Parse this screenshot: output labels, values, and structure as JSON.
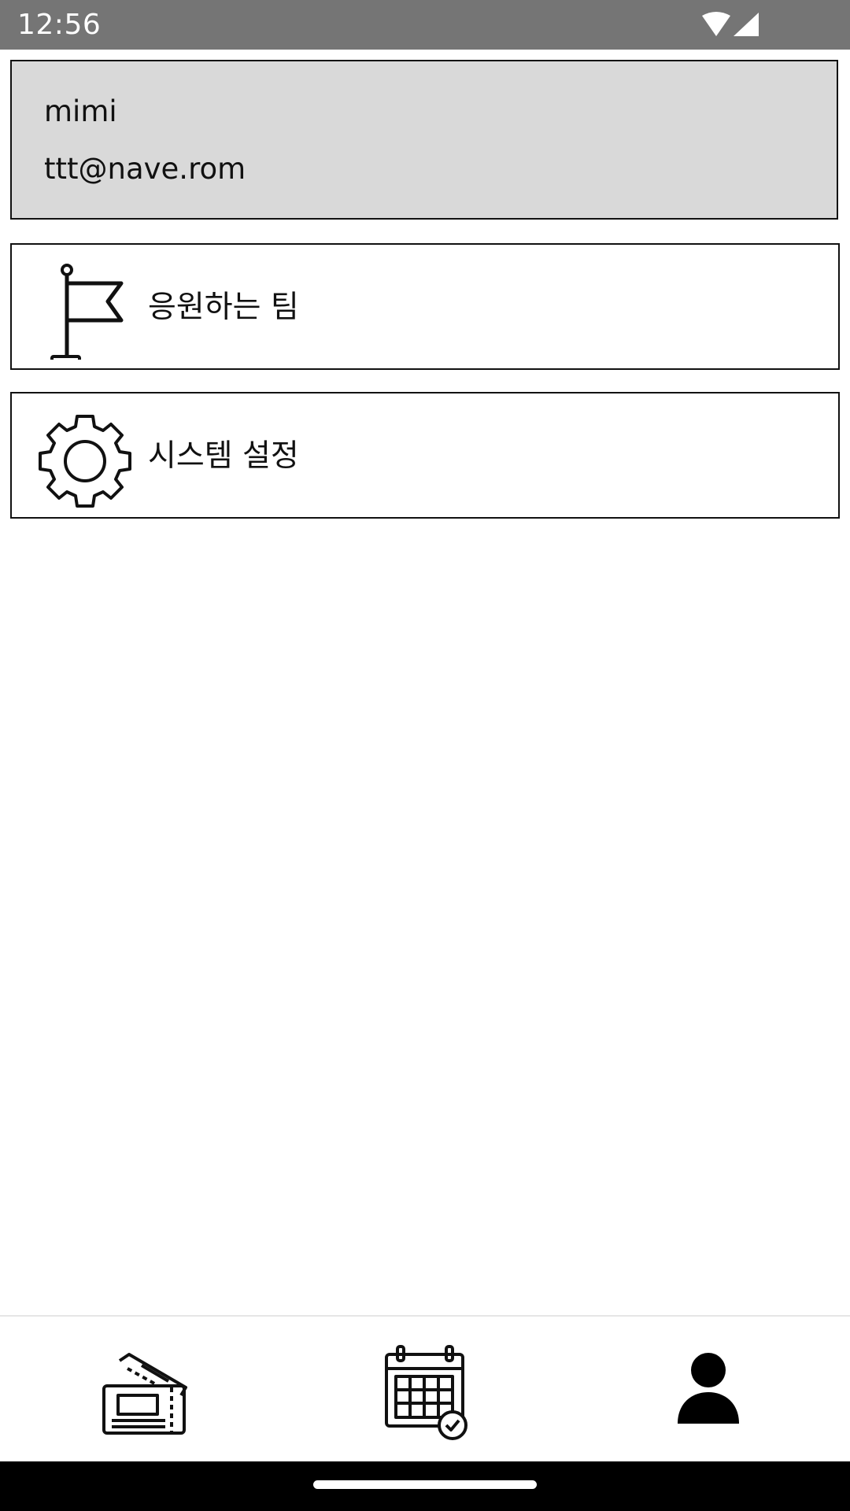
{
  "status_bar": {
    "time": "12:56",
    "icons": [
      "wifi-icon",
      "cellular-signal-icon"
    ]
  },
  "profile": {
    "name": "mimi",
    "email": "ttt@nave.rom"
  },
  "menu": {
    "items": [
      {
        "label": "응원하는 팀",
        "icon": "flag-icon"
      },
      {
        "label": "시스템 설정",
        "icon": "gear-icon"
      }
    ]
  },
  "bottom_nav": {
    "items": [
      {
        "icon": "ticket-icon"
      },
      {
        "icon": "calendar-check-icon"
      },
      {
        "icon": "user-icon",
        "active": true
      }
    ]
  },
  "colors": {
    "status_bar": "#757575",
    "profile_card": "#d9d9d9",
    "border": "#111111",
    "system_bar": "#000000"
  }
}
